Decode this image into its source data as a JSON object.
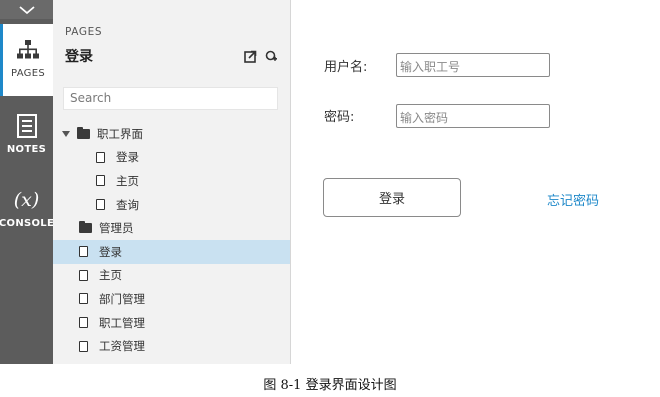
{
  "rail": {
    "tabs": [
      {
        "label": "PAGES",
        "icon": "sitemap-icon",
        "active": true
      },
      {
        "label": "NOTES",
        "icon": "notes-icon",
        "active": false
      },
      {
        "label": "CONSOLE",
        "icon": "variable-x-icon",
        "glyph": "(x)",
        "active": false
      }
    ]
  },
  "panel": {
    "title": "PAGES",
    "current_page": "登录",
    "search": {
      "placeholder": "Search"
    },
    "tree": [
      {
        "label": "职工界面",
        "type": "folder",
        "expanded": true
      },
      {
        "label": "登录",
        "type": "page"
      },
      {
        "label": "主页",
        "type": "page"
      },
      {
        "label": "查询",
        "type": "page"
      },
      {
        "label": "管理员",
        "type": "folder",
        "expanded": false
      },
      {
        "label": "登录",
        "type": "page",
        "selected": true
      },
      {
        "label": "主页",
        "type": "page"
      },
      {
        "label": "部门管理",
        "type": "page"
      },
      {
        "label": "职工管理",
        "type": "page"
      },
      {
        "label": "工资管理",
        "type": "page"
      }
    ]
  },
  "form": {
    "username_label": "用户名:",
    "username_placeholder": "输入职工号",
    "password_label": "密码:",
    "password_placeholder": "输入密码",
    "login_button": "登录",
    "forgot_link": "忘记密码"
  },
  "caption": "图 8-1  登录界面设计图",
  "colors": {
    "accent": "#1e88c9",
    "selected_row": "#c9e1f1",
    "rail": "#5c5c5c"
  }
}
